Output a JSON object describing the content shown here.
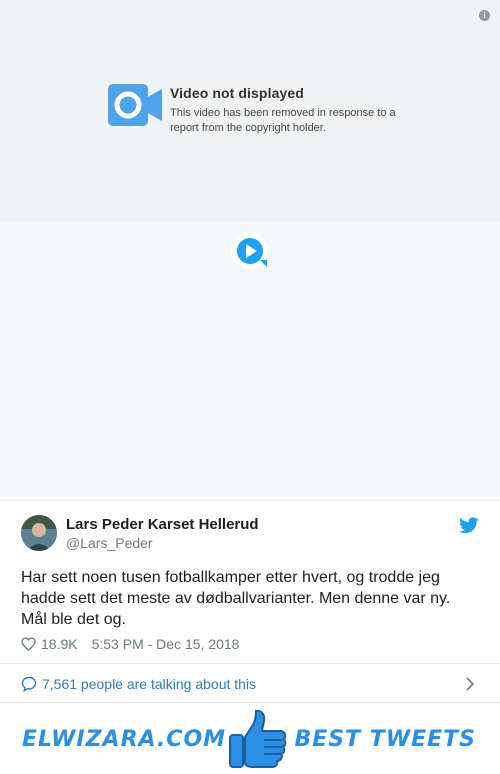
{
  "video": {
    "notice_title": "Video not displayed",
    "notice_text": "This video has been removed in response to a report from the copyright holder.",
    "icons": [
      "info-icon",
      "video-camera-icon",
      "play-icon"
    ]
  },
  "tweet": {
    "author_name": "Lars Peder Karset Hellerud",
    "author_handle": "@Lars_Peder",
    "text": "Har sett noen tusen fotballkamper etter hvert, og trodde jeg hadde sett det meste av dødballvarianter. Men denne var ny. Mål ble det og.",
    "likes": "18.9K",
    "timestamp": "5:53 PM - Dec 15, 2018",
    "talking": "7,561 people are talking about this",
    "icons": [
      "twitter-bird-icon",
      "heart-icon",
      "speech-bubble-icon",
      "chevron-right-icon"
    ]
  },
  "banner": {
    "left_text": "ELWIZARA.COM",
    "right_text": "BEST TWEETS",
    "icon": "thumbs-up-icon"
  },
  "colors": {
    "twitter_blue": "#1da1f2",
    "link_blue": "#2b7bb9",
    "banner_blue": "#2b8fe5",
    "video_bg": "#f5f8fa"
  }
}
